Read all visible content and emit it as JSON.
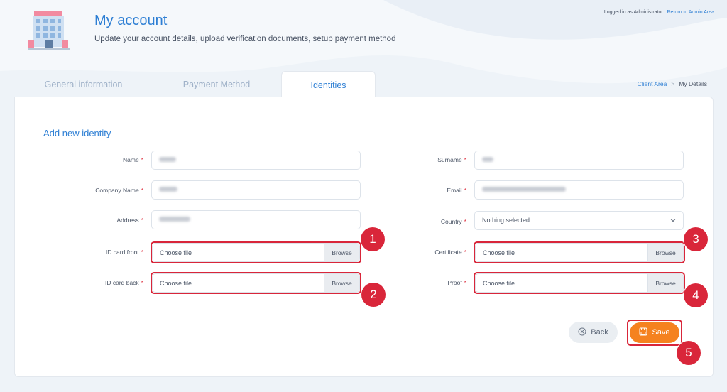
{
  "header": {
    "title": "My account",
    "subtitle": "Update your account details, upload verification documents, setup payment method",
    "logged_in_text": "Logged in as Administrator",
    "separator": " | ",
    "return_link": "Return to Admin Area"
  },
  "tabs": [
    {
      "label": "General information",
      "active": false
    },
    {
      "label": "Payment Method",
      "active": false
    },
    {
      "label": "Identities",
      "active": true
    }
  ],
  "breadcrumb": {
    "items": [
      "Client Area",
      "My Details"
    ],
    "separator": ">"
  },
  "form": {
    "section_title": "Add new identity",
    "required_marker": "*",
    "fields": {
      "name": {
        "label": "Name"
      },
      "surname": {
        "label": "Surname"
      },
      "company_name": {
        "label": "Company Name"
      },
      "email": {
        "label": "Email"
      },
      "address": {
        "label": "Address"
      },
      "country": {
        "label": "Country",
        "value": "Nothing selected"
      },
      "id_card_front": {
        "label": "ID card front",
        "value": "Choose file",
        "button": "Browse"
      },
      "certificate": {
        "label": "Certificate",
        "value": "Choose file",
        "button": "Browse"
      },
      "id_card_back": {
        "label": "ID card back",
        "value": "Choose file",
        "button": "Browse"
      },
      "proof": {
        "label": "Proof",
        "value": "Choose file",
        "button": "Browse"
      }
    },
    "back_label": "Back",
    "save_label": "Save"
  },
  "annotations": [
    "1",
    "2",
    "3",
    "4",
    "5"
  ],
  "colors": {
    "accent": "#2e7fd4",
    "save": "#f5821f",
    "highlight": "#d9263a",
    "required": "#e03846"
  }
}
